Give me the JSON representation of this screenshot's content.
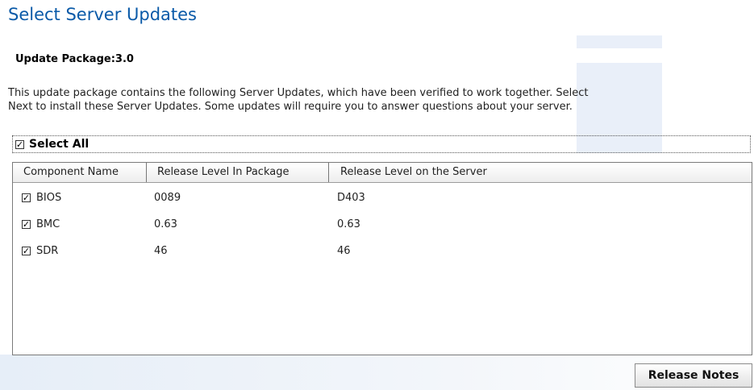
{
  "page": {
    "title": "Select Server Updates",
    "package_label": "Update Package:",
    "package_version": "3.0",
    "description_lines": [
      "This update package contains the following Server Updates, which have been verified to work together. Select",
      "Next to install these Server Updates. Some updates will require you to answer questions about your server."
    ]
  },
  "select_all": {
    "label": "Select All",
    "checked": true
  },
  "table": {
    "columns": [
      "Component Name",
      "Release Level In Package",
      "Release Level on the Server"
    ],
    "rows": [
      {
        "name": "BIOS",
        "package": "0089",
        "server": "D403",
        "checked": true
      },
      {
        "name": "BMC",
        "package": "0.63",
        "server": "0.63",
        "checked": true
      },
      {
        "name": "SDR",
        "package": "46",
        "server": "46",
        "checked": true
      }
    ]
  },
  "buttons": {
    "release_notes": "Release Notes"
  },
  "glyphs": {
    "check": "✓"
  },
  "colors": {
    "title": "#0a5aa8",
    "accent_band": "#e6eef8"
  }
}
